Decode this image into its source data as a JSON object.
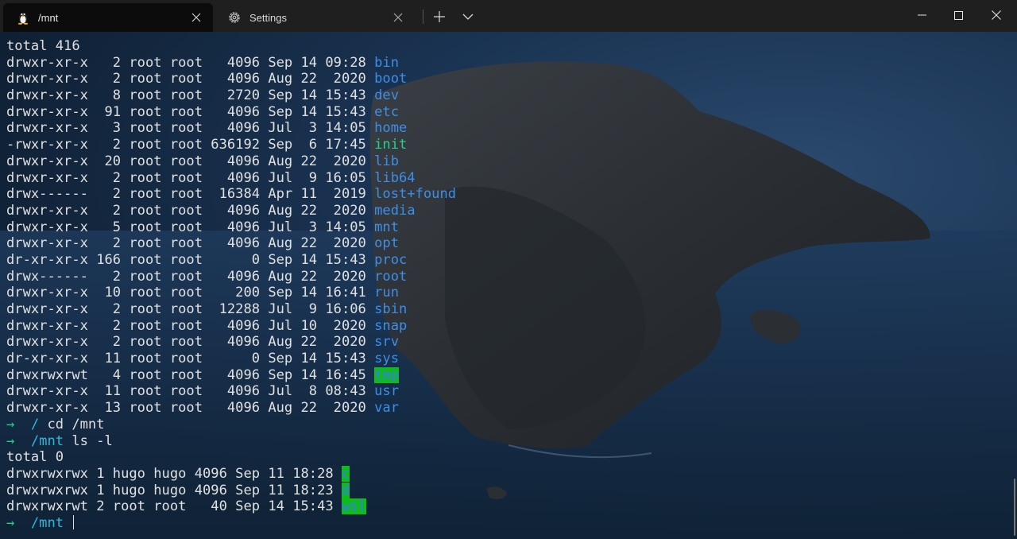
{
  "tabs": [
    {
      "label": "/mnt",
      "icon": "linux-penguin-icon",
      "active": true
    },
    {
      "label": "Settings",
      "icon": "gear-icon",
      "active": false
    }
  ],
  "window_controls": {
    "minimize": "minimize-icon",
    "maximize": "maximize-icon",
    "close": "close-icon"
  },
  "terminal": {
    "listing1_total": "total 416",
    "listing1": [
      {
        "perm": "drwxr-xr-x",
        "links": "  2",
        "owner": "root",
        "group": "root",
        "size": "  4096",
        "date": "Sep 14 09:28",
        "name": "bin",
        "style": "blue"
      },
      {
        "perm": "drwxr-xr-x",
        "links": "  2",
        "owner": "root",
        "group": "root",
        "size": "  4096",
        "date": "Aug 22  2020",
        "name": "boot",
        "style": "blue"
      },
      {
        "perm": "drwxr-xr-x",
        "links": "  8",
        "owner": "root",
        "group": "root",
        "size": "  2720",
        "date": "Sep 14 15:43",
        "name": "dev",
        "style": "blue"
      },
      {
        "perm": "drwxr-xr-x",
        "links": " 91",
        "owner": "root",
        "group": "root",
        "size": "  4096",
        "date": "Sep 14 15:43",
        "name": "etc",
        "style": "blue"
      },
      {
        "perm": "drwxr-xr-x",
        "links": "  3",
        "owner": "root",
        "group": "root",
        "size": "  4096",
        "date": "Jul  3 14:05",
        "name": "home",
        "style": "blue"
      },
      {
        "perm": "-rwxr-xr-x",
        "links": "  2",
        "owner": "root",
        "group": "root",
        "size": "636192",
        "date": "Sep  6 17:45",
        "name": "init",
        "style": "green"
      },
      {
        "perm": "drwxr-xr-x",
        "links": " 20",
        "owner": "root",
        "group": "root",
        "size": "  4096",
        "date": "Aug 22  2020",
        "name": "lib",
        "style": "blue"
      },
      {
        "perm": "drwxr-xr-x",
        "links": "  2",
        "owner": "root",
        "group": "root",
        "size": "  4096",
        "date": "Jul  9 16:05",
        "name": "lib64",
        "style": "blue"
      },
      {
        "perm": "drwx------",
        "links": "  2",
        "owner": "root",
        "group": "root",
        "size": " 16384",
        "date": "Apr 11  2019",
        "name": "lost+found",
        "style": "blue"
      },
      {
        "perm": "drwxr-xr-x",
        "links": "  2",
        "owner": "root",
        "group": "root",
        "size": "  4096",
        "date": "Aug 22  2020",
        "name": "media",
        "style": "blue"
      },
      {
        "perm": "drwxr-xr-x",
        "links": "  5",
        "owner": "root",
        "group": "root",
        "size": "  4096",
        "date": "Jul  3 14:05",
        "name": "mnt",
        "style": "blue"
      },
      {
        "perm": "drwxr-xr-x",
        "links": "  2",
        "owner": "root",
        "group": "root",
        "size": "  4096",
        "date": "Aug 22  2020",
        "name": "opt",
        "style": "blue"
      },
      {
        "perm": "dr-xr-xr-x",
        "links": "166",
        "owner": "root",
        "group": "root",
        "size": "     0",
        "date": "Sep 14 15:43",
        "name": "proc",
        "style": "blue"
      },
      {
        "perm": "drwx------",
        "links": "  2",
        "owner": "root",
        "group": "root",
        "size": "  4096",
        "date": "Aug 22  2020",
        "name": "root",
        "style": "blue"
      },
      {
        "perm": "drwxr-xr-x",
        "links": " 10",
        "owner": "root",
        "group": "root",
        "size": "   200",
        "date": "Sep 14 16:41",
        "name": "run",
        "style": "blue"
      },
      {
        "perm": "drwxr-xr-x",
        "links": "  2",
        "owner": "root",
        "group": "root",
        "size": " 12288",
        "date": "Jul  9 16:06",
        "name": "sbin",
        "style": "blue"
      },
      {
        "perm": "drwxr-xr-x",
        "links": "  2",
        "owner": "root",
        "group": "root",
        "size": "  4096",
        "date": "Jul 10  2020",
        "name": "snap",
        "style": "blue"
      },
      {
        "perm": "drwxr-xr-x",
        "links": "  2",
        "owner": "root",
        "group": "root",
        "size": "  4096",
        "date": "Aug 22  2020",
        "name": "srv",
        "style": "blue"
      },
      {
        "perm": "dr-xr-xr-x",
        "links": " 11",
        "owner": "root",
        "group": "root",
        "size": "     0",
        "date": "Sep 14 15:43",
        "name": "sys",
        "style": "blue"
      },
      {
        "perm": "drwxrwxrwt",
        "links": "  4",
        "owner": "root",
        "group": "root",
        "size": "  4096",
        "date": "Sep 14 16:45",
        "name": "tmp",
        "style": "greenbg"
      },
      {
        "perm": "drwxr-xr-x",
        "links": " 11",
        "owner": "root",
        "group": "root",
        "size": "  4096",
        "date": "Jul  8 08:43",
        "name": "usr",
        "style": "blue"
      },
      {
        "perm": "drwxr-xr-x",
        "links": " 13",
        "owner": "root",
        "group": "root",
        "size": "  4096",
        "date": "Aug 22  2020",
        "name": "var",
        "style": "blue"
      }
    ],
    "prompt1": {
      "arrow": "→",
      "path": "/",
      "command": "cd /mnt"
    },
    "prompt2": {
      "arrow": "→",
      "path": "/mnt",
      "command": "ls -l"
    },
    "listing2_total": "total 0",
    "listing2": [
      {
        "perm": "drwxrwxrwx",
        "links": "1",
        "owner": "hugo",
        "group": "hugo",
        "size": "4096",
        "date": "Sep 11 18:28",
        "name": "c",
        "style": "greenbg"
      },
      {
        "perm": "drwxrwxrwx",
        "links": "1",
        "owner": "hugo",
        "group": "hugo",
        "size": "4096",
        "date": "Sep 11 18:23",
        "name": "d",
        "style": "greenbg"
      },
      {
        "perm": "drwxrwxrwt",
        "links": "2",
        "owner": "root",
        "group": "root",
        "size": "  40",
        "date": "Sep 14 15:43",
        "name": "wsl",
        "style": "greenbg"
      }
    ],
    "prompt3": {
      "arrow": "→",
      "path": "/mnt",
      "command": ""
    }
  },
  "colors": {
    "dir_blue": "#3b8eea",
    "exec_green": "#23d18b",
    "sticky_bg_green": "#0dbc1a",
    "prompt_cyan": "#29b8db"
  }
}
